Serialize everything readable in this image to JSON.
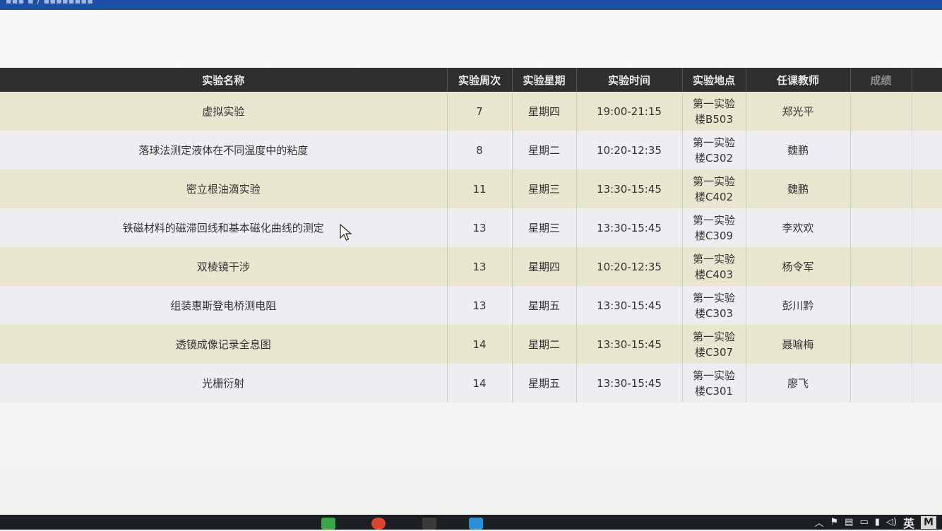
{
  "header": {
    "breadcrumb": "▪▪▪ ▪ / ▪▪▪▪▪▪▪▪"
  },
  "table": {
    "columns": [
      "实验名称",
      "实验周次",
      "实验星期",
      "实验时间",
      "实验地点",
      "任课教师",
      "成绩"
    ],
    "rows": [
      {
        "name": "虚拟实验",
        "week": "7",
        "weekday": "星期四",
        "time": "19:00-21:15",
        "loc1": "第一实验",
        "loc2": "楼B503",
        "teacher": "郑光平",
        "score": ""
      },
      {
        "name": "落球法测定液体在不同温度中的粘度",
        "week": "8",
        "weekday": "星期二",
        "time": "10:20-12:35",
        "loc1": "第一实验",
        "loc2": "楼C302",
        "teacher": "魏鹏",
        "score": ""
      },
      {
        "name": "密立根油滴实验",
        "week": "11",
        "weekday": "星期三",
        "time": "13:30-15:45",
        "loc1": "第一实验",
        "loc2": "楼C402",
        "teacher": "魏鹏",
        "score": ""
      },
      {
        "name": "铁磁材料的磁滞回线和基本磁化曲线的测定",
        "week": "13",
        "weekday": "星期三",
        "time": "13:30-15:45",
        "loc1": "第一实验",
        "loc2": "楼C309",
        "teacher": "李欢欢",
        "score": ""
      },
      {
        "name": "双棱镜干涉",
        "week": "13",
        "weekday": "星期四",
        "time": "10:20-12:35",
        "loc1": "第一实验",
        "loc2": "楼C403",
        "teacher": "杨令军",
        "score": ""
      },
      {
        "name": "组装惠斯登电桥测电阻",
        "week": "13",
        "weekday": "星期五",
        "time": "13:30-15:45",
        "loc1": "第一实验",
        "loc2": "楼C303",
        "teacher": "彭川黔",
        "score": ""
      },
      {
        "name": "透镜成像记录全息图",
        "week": "14",
        "weekday": "星期二",
        "time": "13:30-15:45",
        "loc1": "第一实验",
        "loc2": "楼C307",
        "teacher": "聂喻梅",
        "score": ""
      },
      {
        "name": "光栅衍射",
        "week": "14",
        "weekday": "星期五",
        "time": "13:30-15:45",
        "loc1": "第一实验",
        "loc2": "楼C301",
        "teacher": "廖飞",
        "score": ""
      }
    ]
  },
  "taskbar": {
    "ime_label": "英",
    "m_label": "M",
    "apps": [
      "green-app-icon",
      "red-app-icon",
      "dark-app-icon",
      "blue-app-icon"
    ],
    "tray_icons": [
      "chevron-up-icon",
      "network-icon",
      "keyboard-icon",
      "folder-icon",
      "battery-icon",
      "volume-icon"
    ]
  },
  "colors": {
    "header_bg": "#2f2f31",
    "row_odd": "#e9e6cf",
    "row_even": "#eeeef2",
    "topbar": "#1f4fa5"
  }
}
